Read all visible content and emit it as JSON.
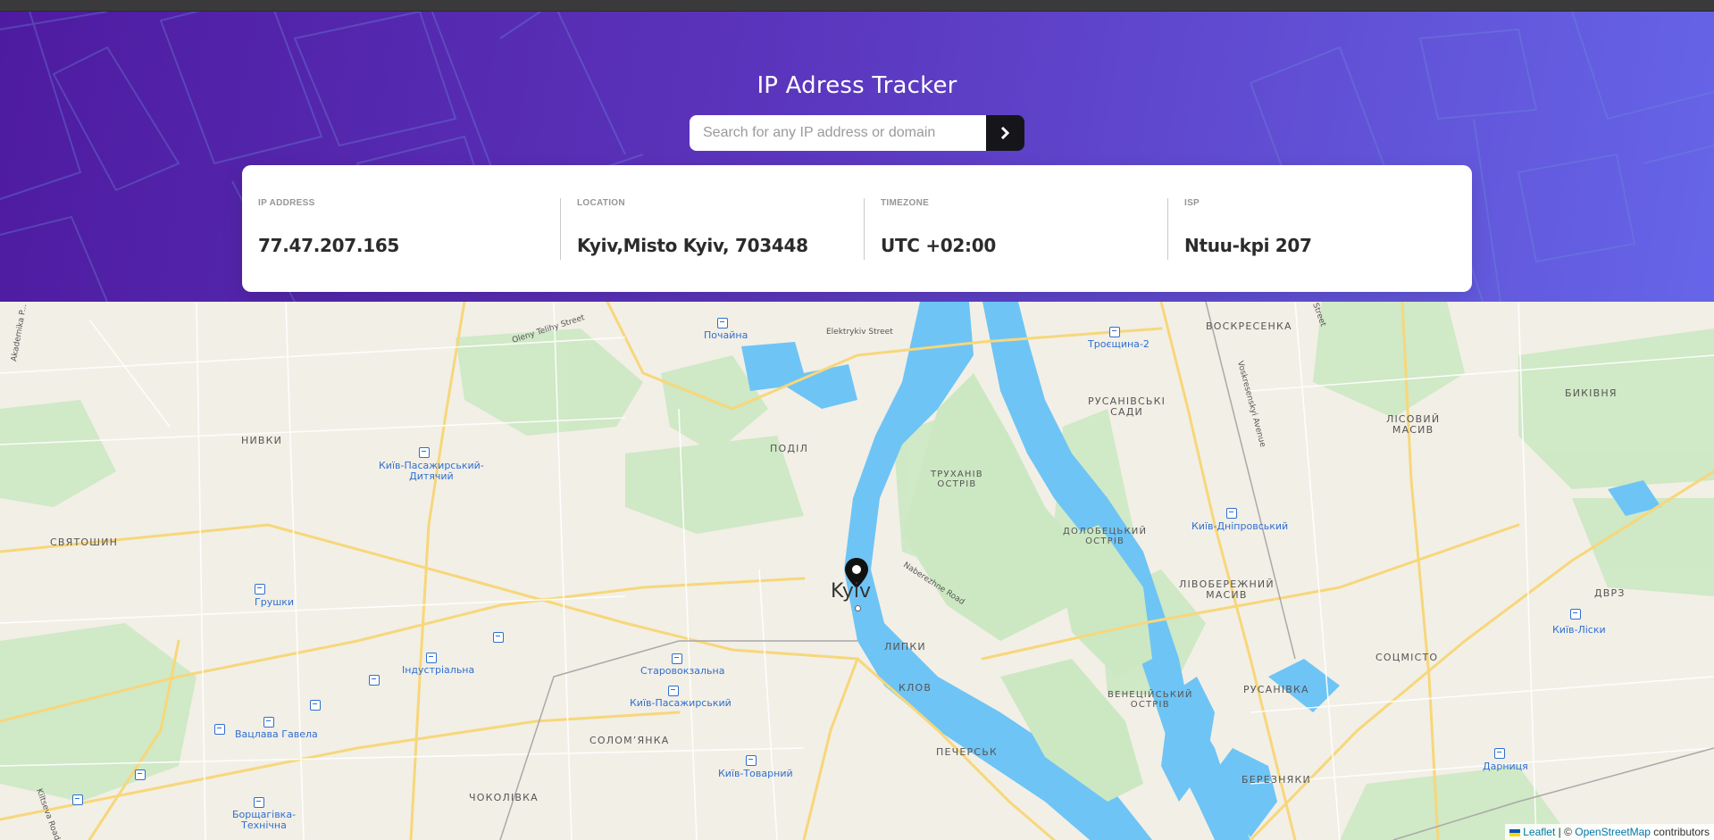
{
  "header": {
    "title": "IP Adress Tracker",
    "search_placeholder": "Search for any IP address or domain",
    "search_value": "",
    "search_button_icon": "chevron-right-icon"
  },
  "info": [
    {
      "label": "IP ADDRESS",
      "value": "77.47.207.165"
    },
    {
      "label": "LOCATION",
      "value": "Kyiv,Misto Kyiv, 703448"
    },
    {
      "label": "TIMEZONE",
      "value": "UTC +02:00"
    },
    {
      "label": "ISP",
      "value": "Ntuu-kpi 207"
    }
  ],
  "map": {
    "city": "Kyiv",
    "marker_icon": "location-pin-icon",
    "districts": {
      "vozkresenka": "ВОСКРЕСЕНКА",
      "rusanivski_sady": "РУСАНІВСЬКІ\nСАДИ",
      "bykivnia": "БИКІВНЯ",
      "lisovyi_masyv": "ЛІСОВИЙ\nМАСИВ",
      "nyvky": "НИВКИ",
      "podil": "ПОДІЛ",
      "trukhaniv": "ТРУХАНІВ\nОСТРІВ",
      "dolobetskyi": "ДОЛОБЕЦЬКИЙ\nОСТРІВ",
      "sviatoshyn": "СВЯТОШИН",
      "livoberezhnyi": "ЛІВОБЕРЕЖНИЙ\nМАСИВ",
      "dvrz": "ДВРЗ",
      "lypky": "ЛИПКИ",
      "sotsmisto": "СОЦМІСТО",
      "klov": "КЛОВ",
      "rusanivka": "РУСАНІВКА",
      "venetsiiskyi": "ВЕНЕЦІЙСЬКИЙ\nОСТРІВ",
      "solomianka": "СОЛОМ’ЯНКА",
      "pechersk": "ПЕЧЕРСЬК",
      "berezniaky": "БЕРЕЗНЯКИ",
      "chokolivka": "ЧОКОЛІВКА"
    },
    "stations": {
      "pochaina": "Почайна",
      "troieshchyna": "Троєщина-2",
      "kyiv_pas_dytiachyi": "Київ-Пасажирський-\nДитячий",
      "kyiv_dniprovskyi": "Київ-Дніпровський",
      "hrushky": "Грушки",
      "kyiv_lisky": "Київ-Ліски",
      "industrialna": "Індустріальна",
      "starovokzalna": "Старовокзальна",
      "kyiv_pasazhyrskyi": "Київ-Пасажирський",
      "vatslava_havela": "Вацлава Гавела",
      "kyiv_tovarnyi": "Київ-Товарний",
      "darnytsia": "Дарниця",
      "borshchahivka": "Борщагівка-\nТехнічна"
    },
    "streets": {
      "oleny_telihy": "Oleny Telihy Street",
      "elektrykiv": "Elektrykiv Street",
      "naberezhne": "Naberezhne Road",
      "voskresenskyi": "Voskresenskyi Avenue",
      "akademika": "Akademika P...",
      "kiltseva": "Kiltseva Road",
      "street_ne": "Street"
    },
    "attribution": {
      "leaflet": "Leaflet",
      "separator": " | © ",
      "osm": "OpenStreetMap",
      "suffix": " contributors"
    }
  },
  "colors": {
    "header_start": "#4e1ba0",
    "header_end": "#6665e8",
    "water": "#6ec4f5",
    "park": "#cce8c2",
    "land": "#f2efe6",
    "road": "#f7d77b",
    "button": "#16161a"
  }
}
